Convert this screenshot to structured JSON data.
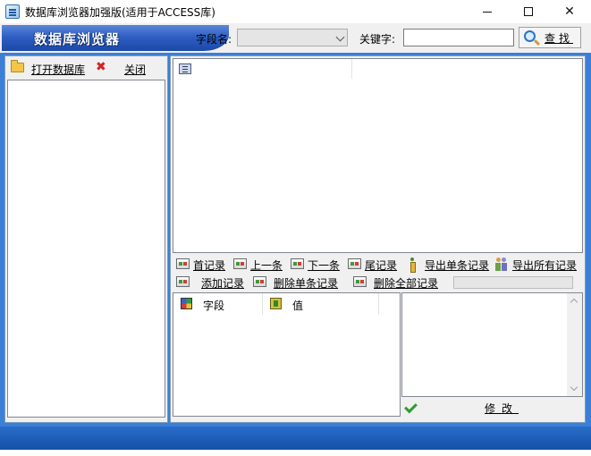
{
  "window": {
    "title": "数据库浏览器加强版(适用于ACCESS库)",
    "minimize_glyph": "",
    "close_glyph": "✕"
  },
  "toolbar": {
    "brand": "数据库浏览器",
    "field_label": "字段名:",
    "field_value": "",
    "keyword_label": "关键字:",
    "keyword_value": "",
    "search_label": "查找"
  },
  "left_panel": {
    "open_db_label": "打开数据库",
    "close_label": "关闭",
    "close_glyph": "✖"
  },
  "navigation": {
    "row1": [
      {
        "label": "首记录",
        "icon": "record-icon"
      },
      {
        "label": "上一条",
        "icon": "record-icon"
      },
      {
        "label": "下一条",
        "icon": "record-icon"
      },
      {
        "label": "尾记录",
        "icon": "record-icon"
      },
      {
        "label": "导出单条记录",
        "icon": "info-icon"
      },
      {
        "label": "导出所有记录",
        "icon": "people-icon"
      }
    ],
    "row2": [
      {
        "label": "添加记录",
        "icon": "record-icon"
      },
      {
        "label": "删除单条记录",
        "icon": "record-icon"
      },
      {
        "label": "删除全部记录",
        "icon": "record-icon"
      }
    ],
    "progress": 0
  },
  "field_grid": {
    "columns": [
      "字段",
      "值"
    ]
  },
  "editor": {
    "value": "",
    "modify_label": "修改"
  },
  "colors": {
    "accent_blue": "#3b7fd8",
    "brand_blue": "#2f5fc4",
    "status_blue": "#1450a8",
    "close_red": "#d62020",
    "check_green": "#2f9a2f"
  }
}
